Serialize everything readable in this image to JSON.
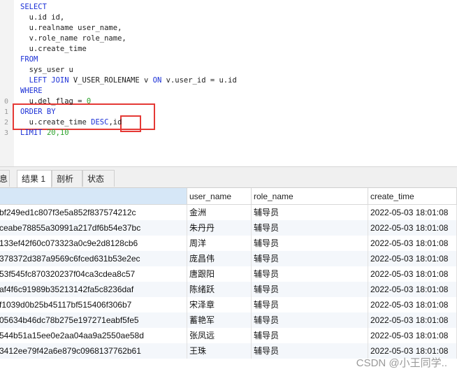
{
  "sql": {
    "lines": [
      {
        "n": "",
        "parts": [
          {
            "t": "SELECT",
            "c": "kw"
          }
        ]
      },
      {
        "n": "",
        "parts": [
          {
            "t": "  u.id id,",
            "c": "id"
          }
        ]
      },
      {
        "n": "",
        "parts": [
          {
            "t": "  u.realname user_name,",
            "c": "id"
          }
        ]
      },
      {
        "n": "",
        "parts": [
          {
            "t": "  v.role_name role_name,",
            "c": "id"
          }
        ]
      },
      {
        "n": "",
        "parts": [
          {
            "t": "  u.create_time",
            "c": "id"
          }
        ]
      },
      {
        "n": "",
        "parts": [
          {
            "t": "FROM",
            "c": "kw"
          }
        ]
      },
      {
        "n": "",
        "parts": [
          {
            "t": "  sys_user u",
            "c": "id"
          }
        ]
      },
      {
        "n": "",
        "parts": [
          {
            "t": "  LEFT JOIN ",
            "c": "kw"
          },
          {
            "t": "V_USER_ROLENAME v ",
            "c": "id"
          },
          {
            "t": "ON ",
            "c": "kw"
          },
          {
            "t": "v.user_id = u.id",
            "c": "id"
          }
        ]
      },
      {
        "n": "",
        "parts": [
          {
            "t": "WHERE",
            "c": "kw"
          }
        ]
      },
      {
        "n": "0",
        "parts": [
          {
            "t": "  u.del_flag = ",
            "c": "id"
          },
          {
            "t": "0",
            "c": "num"
          }
        ]
      },
      {
        "n": "1",
        "parts": [
          {
            "t": "ORDER BY",
            "c": "kw"
          }
        ]
      },
      {
        "n": "2",
        "parts": [
          {
            "t": "  u.create_time ",
            "c": "id"
          },
          {
            "t": "DESC",
            "c": "kw"
          },
          {
            "t": ",id",
            "c": "id"
          }
        ]
      },
      {
        "n": "3",
        "parts": [
          {
            "t": "LIMIT ",
            "c": "kw"
          },
          {
            "t": "20,10",
            "c": "num"
          }
        ]
      }
    ],
    "colors": {
      "keyword": "#1a2fd6",
      "number": "#2da32d",
      "highlight": "#e53935"
    }
  },
  "tabs": [
    {
      "label": "息",
      "active": false
    },
    {
      "label": "结果 1",
      "active": true
    },
    {
      "label": "剖析",
      "active": false
    },
    {
      "label": "状态",
      "active": false
    }
  ],
  "grid": {
    "columns": [
      "",
      "user_name",
      "role_name",
      "create_time"
    ],
    "rows": [
      [
        "bf249ed1c807f3e5a852f837574212c",
        "金洲",
        "辅导员",
        "2022-05-03 18:01:08"
      ],
      [
        "ceabe78855a30991a217df6b54e37bc",
        "朱丹丹",
        "辅导员",
        "2022-05-03 18:01:08"
      ],
      [
        "133ef42f60c073323a0c9e2d8128cb6",
        "周洋",
        "辅导员",
        "2022-05-03 18:01:08"
      ],
      [
        "378372d387a9569c6fced631b53e2ec",
        "庞昌伟",
        "辅导员",
        "2022-05-03 18:01:08"
      ],
      [
        "53f545fc870320237f04ca3cdea8c57",
        "唐跟阳",
        "辅导员",
        "2022-05-03 18:01:08"
      ],
      [
        "af4f6c91989b35213142fa5c8236daf",
        "陈绪跃",
        "辅导员",
        "2022-05-03 18:01:08"
      ],
      [
        "f1039d0b25b45117bf515406f306b7",
        "宋泽章",
        "辅导员",
        "2022-05-03 18:01:08"
      ],
      [
        "05634b46dc78b275e197271eabf5fe5",
        "蓄艳军",
        "辅导员",
        "2022-05-03 18:01:08"
      ],
      [
        "544b51a15ee0e2aa04aa9a2550ae58d",
        "张凤远",
        "辅导员",
        "2022-05-03 18:01:08"
      ],
      [
        "3412ee79f42a6e879c0968137762b61",
        "王珠",
        "辅导员",
        "2022-05-03 18:01:08"
      ]
    ]
  },
  "watermark": "CSDN @小王同学.."
}
